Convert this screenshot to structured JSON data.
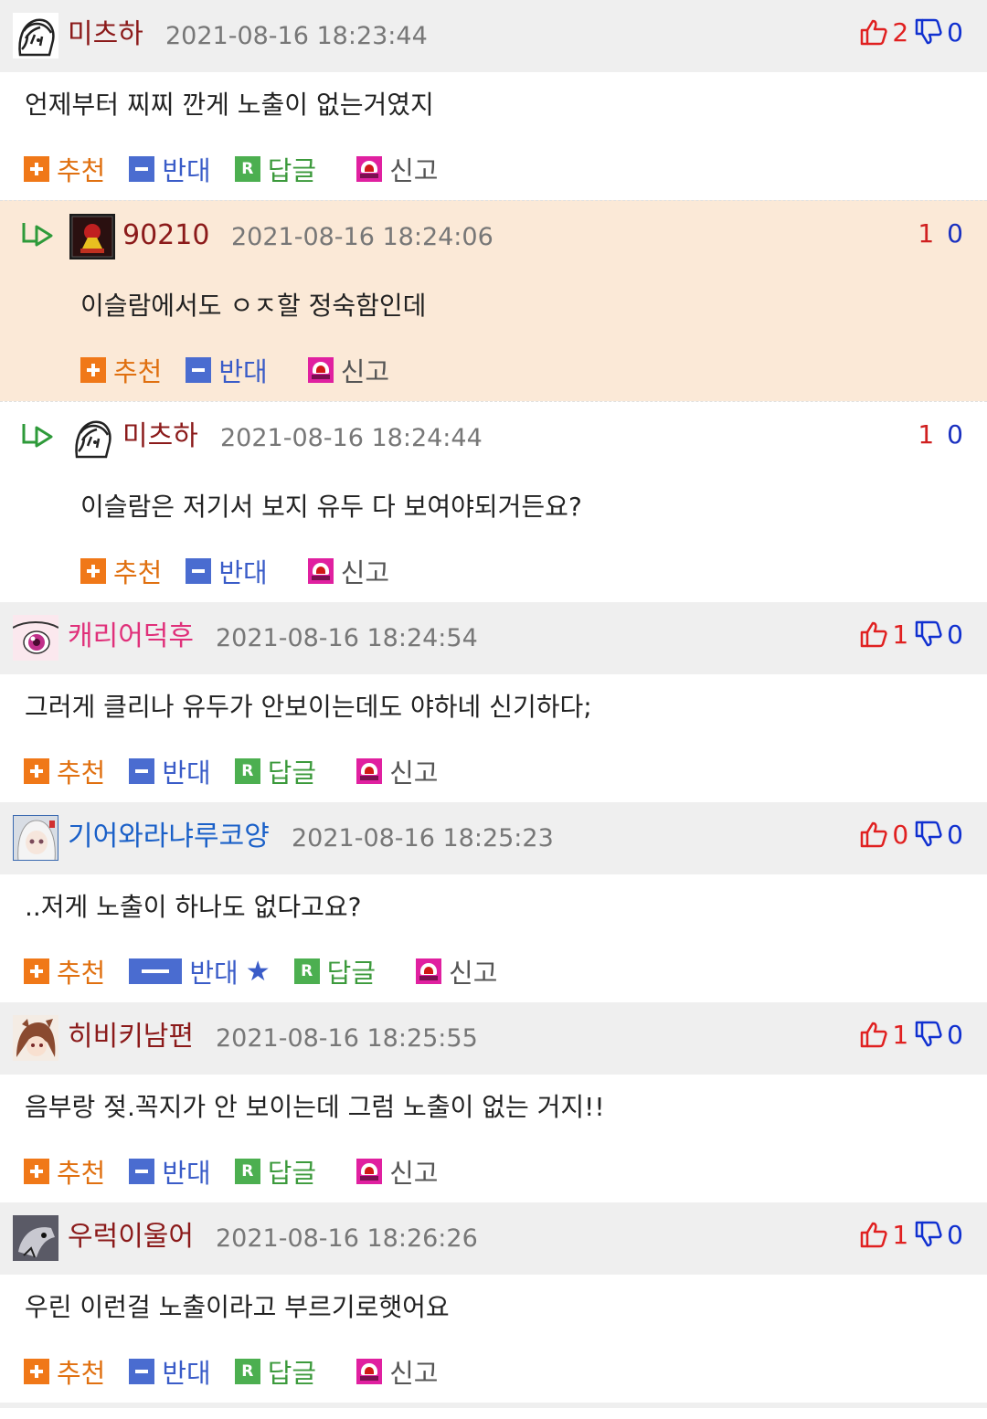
{
  "comments": [
    {
      "nick": "미츠하",
      "nick_color": "#8b1a1a",
      "date": "2021-08-16 18:23:44",
      "up": "2",
      "down": "0",
      "text": "언제부터 찌찌 깐게 노출이 없는거였지",
      "reply": false,
      "avatar": "anime-girl-avatar-icon"
    },
    {
      "nick": "90210",
      "nick_color": "#8b1a1a",
      "date": "2021-08-16 18:24:06",
      "up": "1",
      "down": "0",
      "text": "이슬람에서도 ㅇㅈ할 정숙함인데",
      "reply": true,
      "highlight": true,
      "avatar": "dark-poster-avatar-icon"
    },
    {
      "nick": "미츠하",
      "nick_color": "#8b1a1a",
      "date": "2021-08-16 18:24:44",
      "up": "1",
      "down": "0",
      "text": "이슬람은 저기서 보지 유두 다 보여야되거든요?",
      "reply": true,
      "highlight": false,
      "avatar": "anime-girl-avatar-icon"
    },
    {
      "nick": "캐리어덕후",
      "nick_color": "#e0307a",
      "date": "2021-08-16 18:24:54",
      "up": "1",
      "down": "0",
      "text": "그러게 클리나 유두가 안보이는데도 야하네 신기하다;",
      "reply": false,
      "avatar": "pink-eye-avatar-icon"
    },
    {
      "nick": "기어와라냐루코양",
      "nick_color": "#1a60c8",
      "date": "2021-08-16 18:25:23",
      "up": "0",
      "down": "0",
      "text": "..저게 노출이 하나도 없다고요?",
      "reply": false,
      "avatar": "white-hair-avatar-icon",
      "opposed": true
    },
    {
      "nick": "히비키남편",
      "nick_color": "#8b1a1a",
      "date": "2021-08-16 18:25:55",
      "up": "1",
      "down": "0",
      "text": "음부랑 젖.꼭지가 안 보이는데 그럼 노출이 없는 거지!!",
      "reply": false,
      "avatar": "brown-hair-avatar-icon"
    },
    {
      "nick": "우럭이울어",
      "nick_color": "#8b1a1a",
      "date": "2021-08-16 18:26:26",
      "up": "1",
      "down": "0",
      "text": "우린 이런걸 노출이라고 부르기로햇어요",
      "reply": false,
      "avatar": "gray-creature-avatar-icon"
    }
  ],
  "actions": {
    "recommend": "추천",
    "oppose": "반대",
    "reply": "답글",
    "report": "신고",
    "reply_badge": "R",
    "star": "★"
  },
  "colors": {
    "header_bg": "#efefef",
    "highlight_bg": "#fbe9d7",
    "up": "#e02020",
    "down": "#1030d0"
  }
}
